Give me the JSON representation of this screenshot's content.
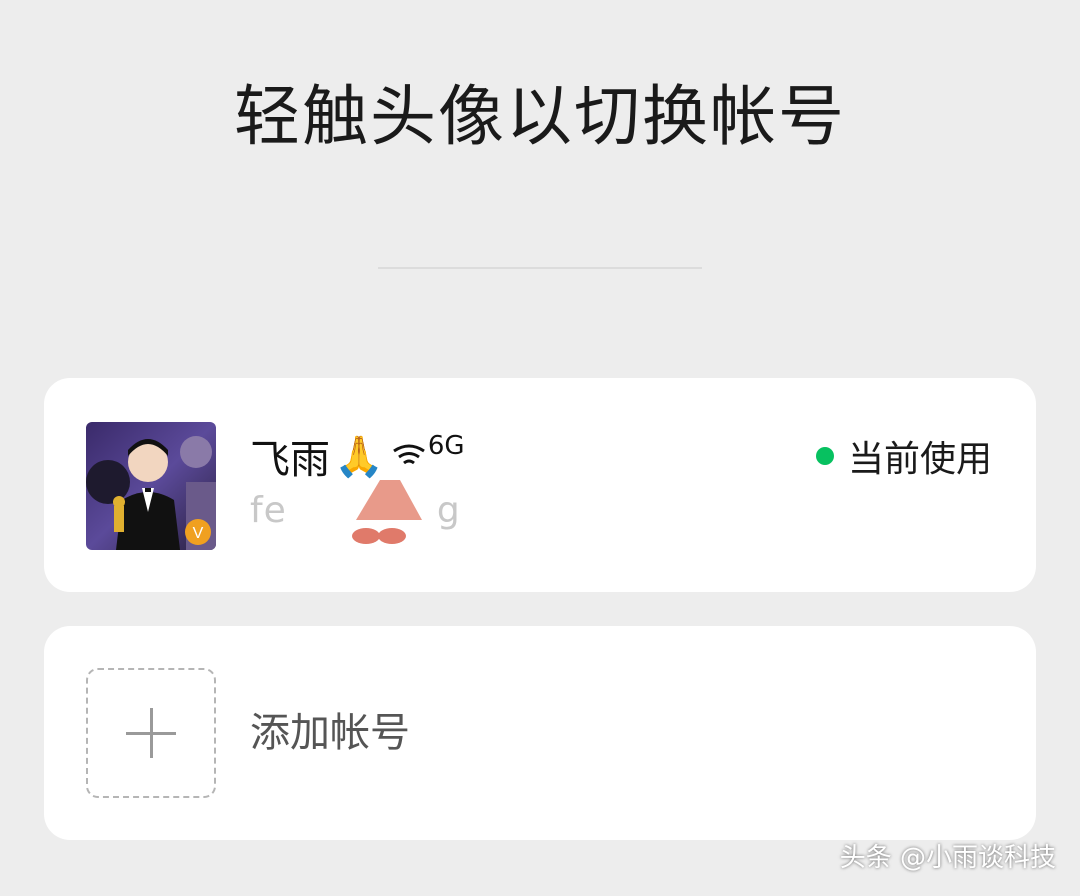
{
  "title": "轻触头像以切换帐号",
  "account": {
    "name": "飞雨",
    "name_emoji": "🙏",
    "signal_label": "6G",
    "wechat_id_start": "fe",
    "wechat_id_end": "g",
    "status_label": "当前使用",
    "status_color": "#07c160",
    "avatar_badge": "V"
  },
  "add_account": {
    "label": "添加帐号"
  },
  "watermark": "头条 @小雨谈科技",
  "colors": {
    "background": "#ededed",
    "card": "#ffffff",
    "accent_green": "#07c160",
    "badge_orange": "#f0a020"
  }
}
